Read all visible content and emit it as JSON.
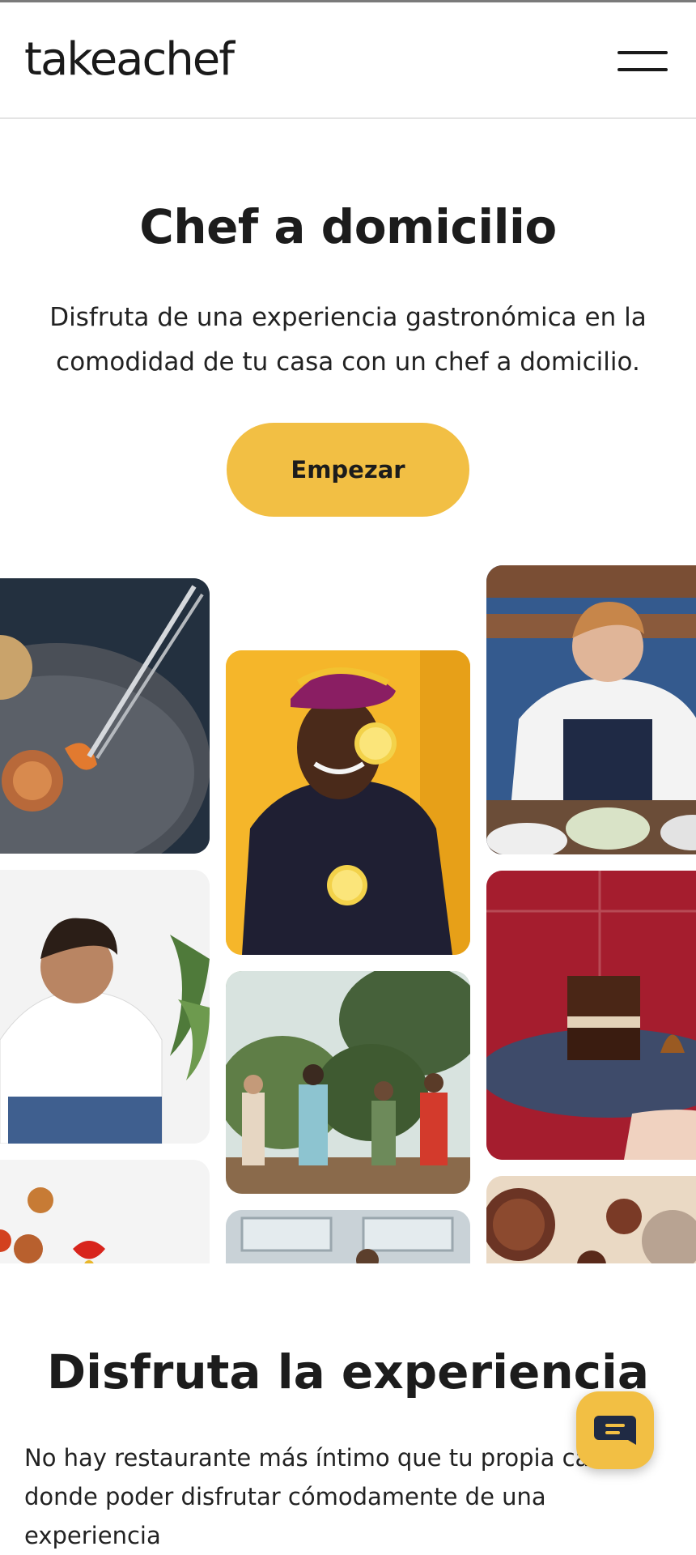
{
  "header": {
    "logo": "takeachef",
    "menu_icon": "hamburger-menu-icon"
  },
  "hero": {
    "title": "Chef a domicilio",
    "subtitle": "Disfruta de una experiencia gastronómica en la comodidad de tu casa con un chef a domicilio.",
    "cta_label": "Empezar"
  },
  "gallery": {
    "images": [
      {
        "name": "plating-tweezers-photo"
      },
      {
        "name": "chef-lemon-yellow-photo"
      },
      {
        "name": "chef-seated-table-photo"
      },
      {
        "name": "chef-smiling-white-photo"
      },
      {
        "name": "friends-garden-dinner-photo"
      },
      {
        "name": "brownie-dessert-plate-photo"
      },
      {
        "name": "plated-appetizers-photo"
      },
      {
        "name": "kitchen-window-photo"
      },
      {
        "name": "ceramic-bowls-photo"
      }
    ]
  },
  "experience": {
    "title": "Disfruta la experiencia",
    "text": "No hay restaurante más íntimo que tu propia casa, donde poder disfrutar cómodamente de una experiencia"
  },
  "chat": {
    "icon": "chat-bubble-icon"
  },
  "colors": {
    "accent": "#f2bf44",
    "text": "#1c1c1c",
    "divider": "#e4e4e4"
  }
}
